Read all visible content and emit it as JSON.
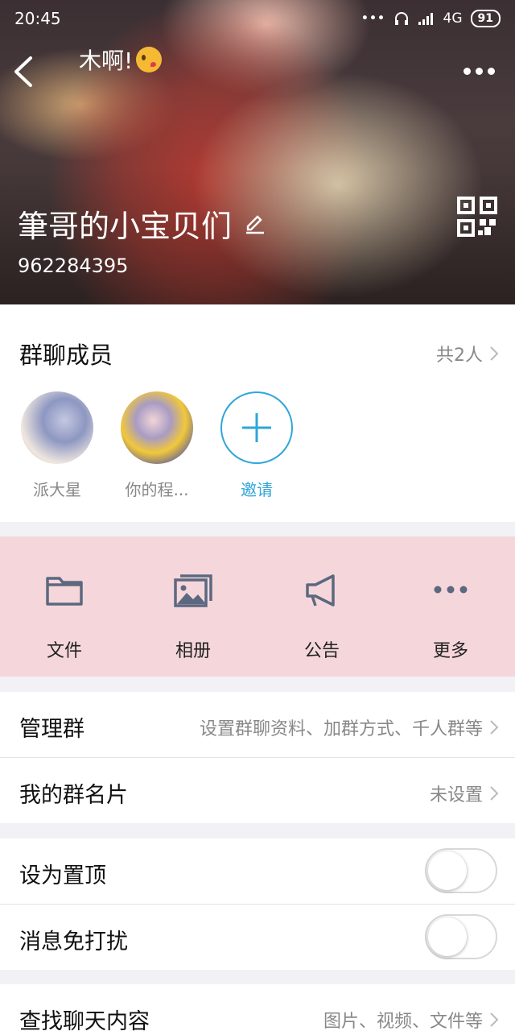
{
  "status_bar": {
    "time": "20:45",
    "network": "4G",
    "battery": "91"
  },
  "header": {
    "chat_name": "木啊!",
    "group_name": "筆哥的小宝贝们",
    "group_id": "962284395"
  },
  "members": {
    "title": "群聊成员",
    "count": "共2人",
    "items": [
      {
        "name": "派大星"
      },
      {
        "name": "你的程..."
      }
    ],
    "invite_label": "邀请"
  },
  "actions": [
    {
      "label": "文件",
      "icon": "folder-icon"
    },
    {
      "label": "相册",
      "icon": "photo-album-icon"
    },
    {
      "label": "公告",
      "icon": "megaphone-icon"
    },
    {
      "label": "更多",
      "icon": "more-dots-icon"
    }
  ],
  "settings": {
    "manage": {
      "label": "管理群",
      "value": "设置群聊资料、加群方式、千人群等"
    },
    "card": {
      "label": "我的群名片",
      "value": "未设置"
    },
    "pin": {
      "label": "设为置顶",
      "on": false
    },
    "mute": {
      "label": "消息免打扰",
      "on": false
    },
    "search": {
      "label": "查找聊天内容",
      "value": "图片、视频、文件等"
    }
  },
  "colors": {
    "accent": "#2fa6d9",
    "action_bg": "#f5d7db"
  }
}
